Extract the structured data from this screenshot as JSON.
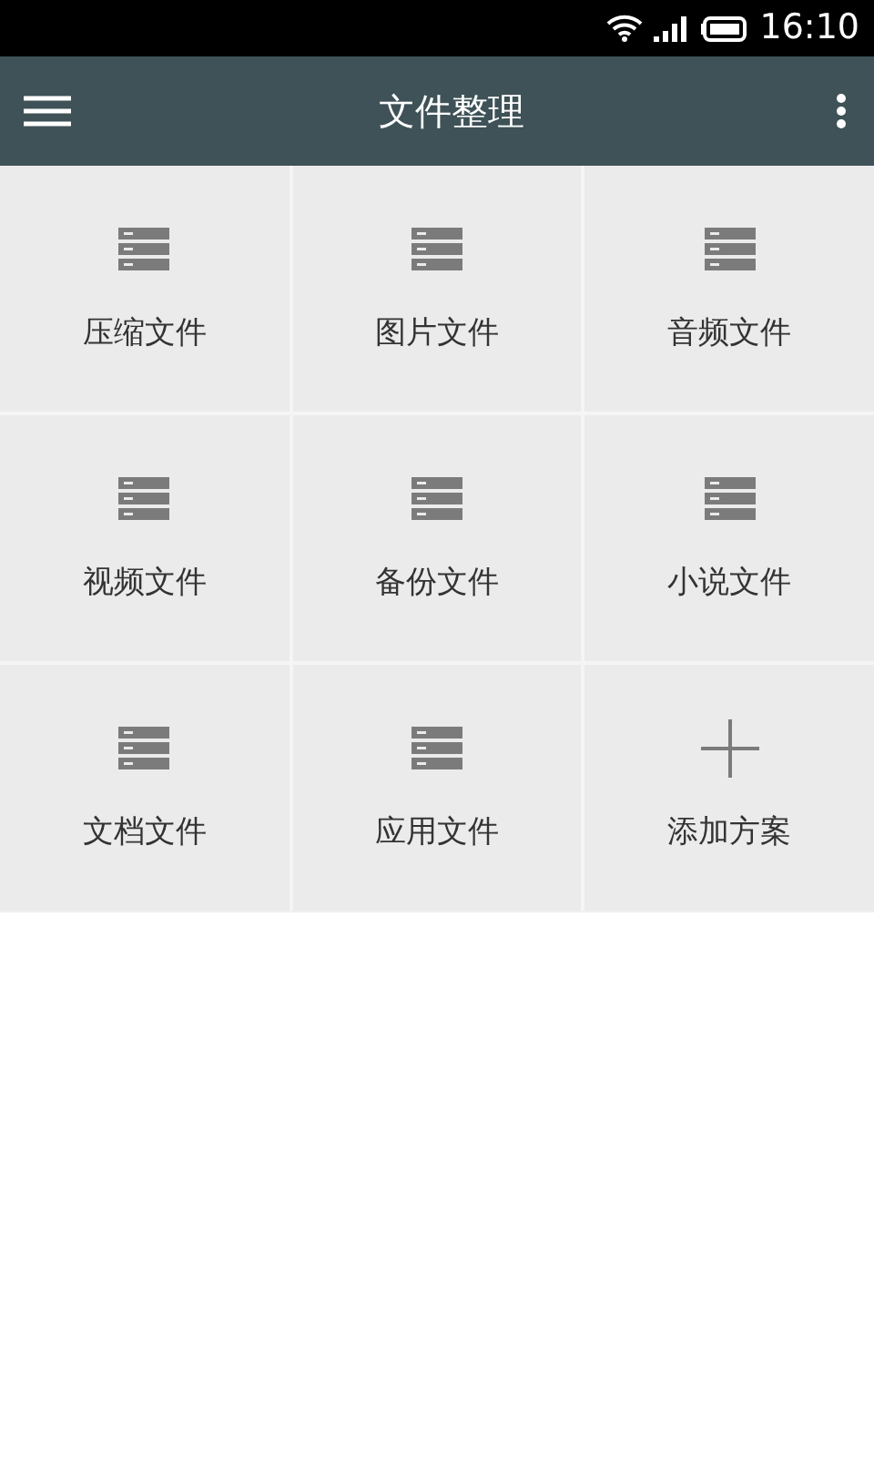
{
  "status_bar": {
    "time": "16:10"
  },
  "app_bar": {
    "title": "文件整理"
  },
  "categories": [
    {
      "kind": "folder",
      "label": "压缩文件"
    },
    {
      "kind": "folder",
      "label": "图片文件"
    },
    {
      "kind": "folder",
      "label": "音频文件"
    },
    {
      "kind": "folder",
      "label": "视频文件"
    },
    {
      "kind": "folder",
      "label": "备份文件"
    },
    {
      "kind": "folder",
      "label": "小说文件"
    },
    {
      "kind": "folder",
      "label": "文档文件"
    },
    {
      "kind": "folder",
      "label": "应用文件"
    },
    {
      "kind": "add",
      "label": "添加方案"
    }
  ]
}
